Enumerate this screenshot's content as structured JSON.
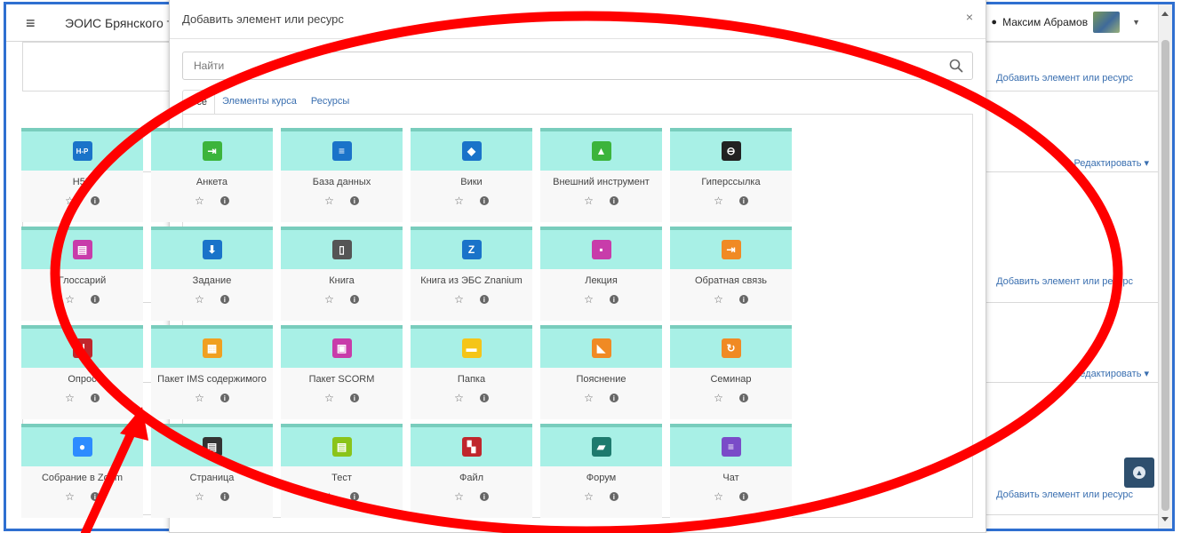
{
  "navbar": {
    "site_title": "ЭОИС Брянского т",
    "user_name": "Максим Абрамов"
  },
  "background": {
    "add_link_1": "Добавить элемент или ресурс",
    "add_link_2": "Добавить элемент или ресурс",
    "add_link_3": "Добавить элемент или ресурс",
    "edit_1": "Редактировать ▾",
    "edit_2": "Редактировать ▾"
  },
  "modal": {
    "title": "Добавить элемент или ресурс",
    "close": "×",
    "search_placeholder": "Найти",
    "tabs": [
      "Все",
      "Элементы курса",
      "Ресурсы"
    ],
    "active_tab": "Все"
  },
  "modules": [
    {
      "label": "H5P",
      "icon": "h5p-icon",
      "color": "#1a73c9"
    },
    {
      "label": "Анкета",
      "icon": "feedback-enter-icon",
      "color": "#3cb43c"
    },
    {
      "label": "База данных",
      "icon": "database-icon",
      "color": "#1a73c9"
    },
    {
      "label": "Вики",
      "icon": "layers-icon",
      "color": "#1a73c9"
    },
    {
      "label": "Внешний инструмент",
      "icon": "cloud-upload-icon",
      "color": "#3cb43c"
    },
    {
      "label": "Гиперссылка",
      "icon": "link-icon",
      "color": "#222222"
    },
    {
      "label": "Глоссарий",
      "icon": "glossary-icon",
      "color": "#c83caa"
    },
    {
      "label": "Задание",
      "icon": "assignment-icon",
      "color": "#1a73c9"
    },
    {
      "label": "Книга",
      "icon": "book-icon",
      "color": "#555555"
    },
    {
      "label": "Книга из ЭБС Znanium",
      "icon": "znanium-icon",
      "color": "#1a73c9"
    },
    {
      "label": "Лекция",
      "icon": "lesson-icon",
      "color": "#c83caa"
    },
    {
      "label": "Обратная связь",
      "icon": "feedback-icon",
      "color": "#f08a24"
    },
    {
      "label": "Опрос",
      "icon": "poll-icon",
      "color": "#c0262c"
    },
    {
      "label": "Пакет IMS содержимого",
      "icon": "ims-package-icon",
      "color": "#f0a020"
    },
    {
      "label": "Пакет SCORM",
      "icon": "scorm-package-icon",
      "color": "#c83caa"
    },
    {
      "label": "Папка",
      "icon": "folder-icon",
      "color": "#f5c518"
    },
    {
      "label": "Пояснение",
      "icon": "label-tag-icon",
      "color": "#f08a24"
    },
    {
      "label": "Семинар",
      "icon": "workshop-icon",
      "color": "#f08a24"
    },
    {
      "label": "Собрание в Zoom",
      "icon": "zoom-icon",
      "color": "#2d8cff"
    },
    {
      "label": "Страница",
      "icon": "page-icon",
      "color": "#333333"
    },
    {
      "label": "Тест",
      "icon": "quiz-icon",
      "color": "#8ac41a"
    },
    {
      "label": "Файл",
      "icon": "file-icon",
      "color": "#c0262c"
    },
    {
      "label": "Форум",
      "icon": "forum-icon",
      "color": "#1e7a6e"
    },
    {
      "label": "Чат",
      "icon": "chat-icon",
      "color": "#7a4bc8"
    }
  ],
  "glyphs": {
    "H5P": "H-P",
    "Анкета": "⇥",
    "База данных": "≡",
    "Вики": "◆",
    "Внешний инструмент": "▲",
    "Гиперссылка": "⊖",
    "Глоссарий": "▤",
    "Задание": "⬇",
    "Книга": "▯",
    "Книга из ЭБС Znanium": "Z",
    "Лекция": "▪",
    "Обратная связь": "⇥",
    "Опрос": "ıl",
    "Пакет IMS содержимого": "▦",
    "Пакет SCORM": "▣",
    "Папка": "▬",
    "Пояснение": "◣",
    "Семинар": "↻",
    "Собрание в Zoom": "●",
    "Страница": "▤",
    "Тест": "▤",
    "Файл": "▚",
    "Форум": "▰",
    "Чат": "≡"
  },
  "colors": {
    "card_top": "#a8f0e6",
    "card_top_border": "#79cdbd",
    "annotation": "#ff0000"
  }
}
